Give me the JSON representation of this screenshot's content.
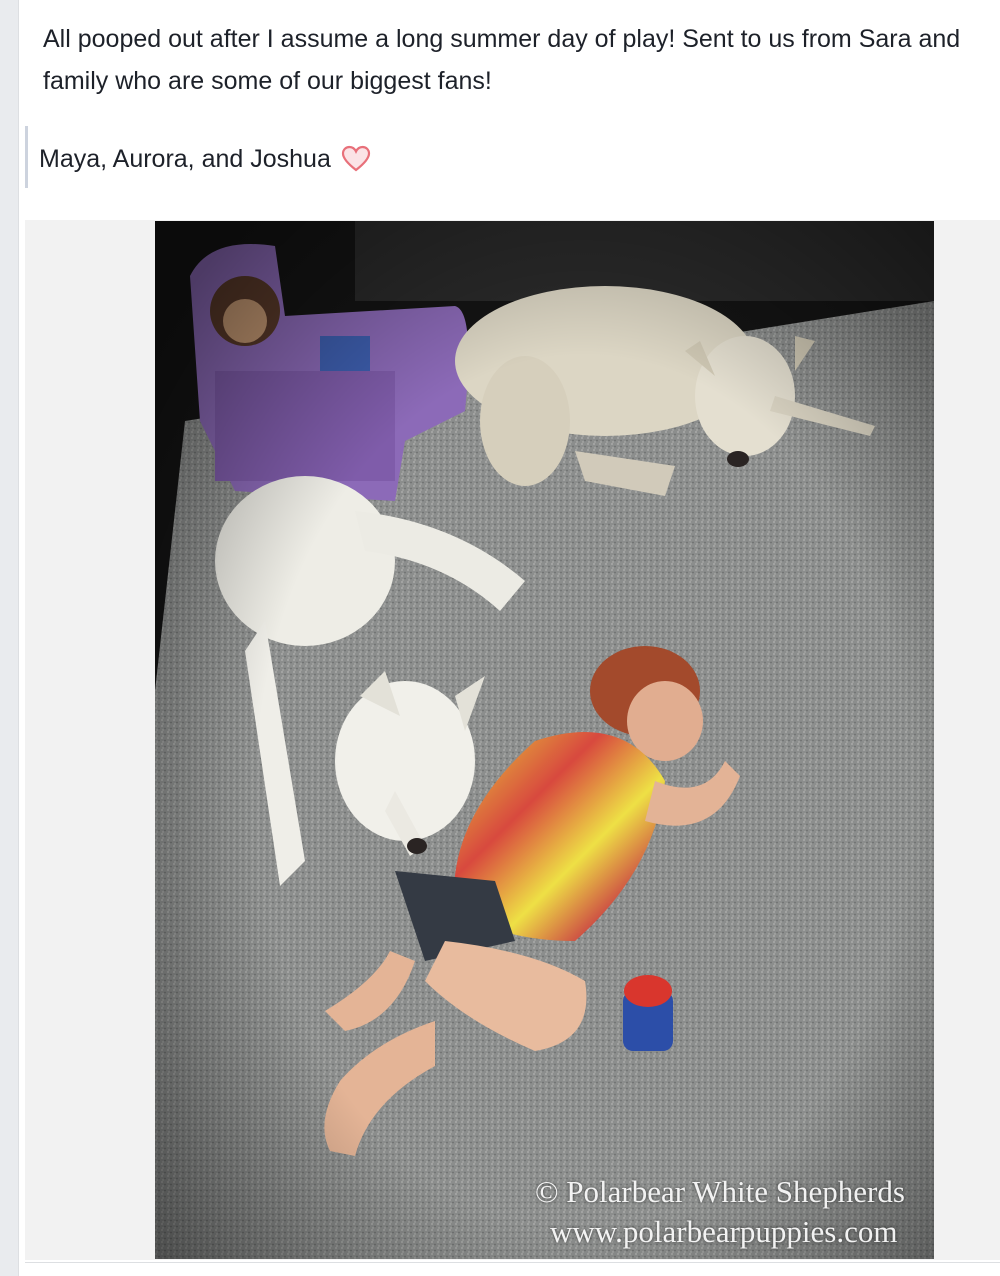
{
  "post": {
    "text": "All pooped out after I assume a long summer day of play! Sent to us from Sara and family who are some of our biggest fans!",
    "quote": "Maya, Aurora, and Joshua"
  },
  "photo": {
    "icon": "heart-icon",
    "watermark_line1": "© Polarbear White Shepherds",
    "watermark_line2": "www.polarbearpuppies.com"
  },
  "colors": {
    "background": "#e9ebee",
    "text": "#1d2129",
    "heart": "#e8707a",
    "carpet": "#8b8d8c"
  }
}
